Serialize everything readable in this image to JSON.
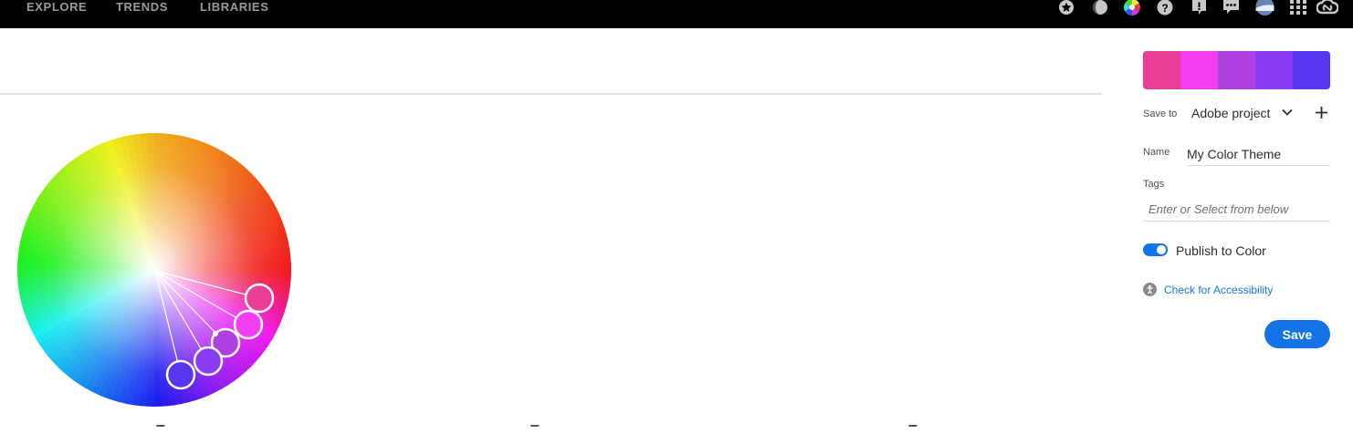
{
  "nav": {
    "items": [
      {
        "label": "EXPLORE"
      },
      {
        "label": "TRENDS"
      },
      {
        "label": "LIBRARIES"
      }
    ]
  },
  "toolbar_icons": [
    "favorite-star-icon",
    "color-mode-icon",
    "color-wheel-icon",
    "help-icon",
    "alert-icon",
    "feedback-icon",
    "user-avatar-icon",
    "apps-grid-icon",
    "creative-cloud-icon"
  ],
  "palette": {
    "swatches": [
      "#ea3e96",
      "#f23ef0",
      "#b03fe0",
      "#8a3cf4",
      "#5a35ef"
    ]
  },
  "panel": {
    "save_to_label": "Save to",
    "save_to_value": "Adobe project",
    "name_label": "Name",
    "name_value": "My Color Theme",
    "tags_label": "Tags",
    "tags_placeholder": "Enter or Select from below",
    "publish_label": "Publish to Color",
    "publish_enabled": true,
    "accessibility_link": "Check for Accessibility",
    "save_button": "Save"
  },
  "colors": {
    "accent": "#1473e6",
    "topbar": "#000000"
  }
}
